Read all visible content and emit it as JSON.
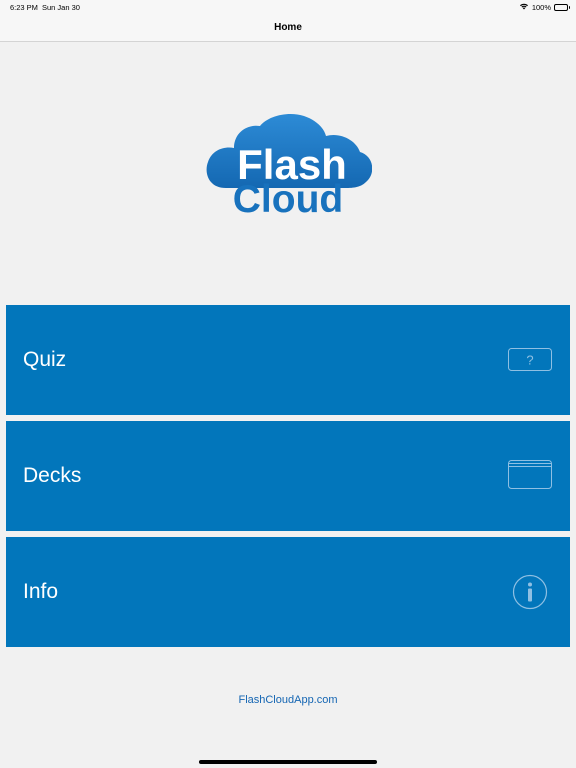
{
  "status_bar": {
    "time": "6:23 PM",
    "date": "Sun Jan 30",
    "battery": "100%"
  },
  "nav": {
    "title": "Home"
  },
  "logo": {
    "line1": "Flash",
    "line2": "Cloud",
    "color": "#1872bd"
  },
  "menu": {
    "quiz_label": "Quiz",
    "quiz_icon_text": "?",
    "decks_label": "Decks",
    "info_label": "Info"
  },
  "footer": {
    "link_text": "FlashCloudApp.com"
  },
  "colors": {
    "button_blue": "#0276bb",
    "background": "#f1f1f1",
    "link": "#1566b3"
  },
  "icons": {
    "quiz": "question-card-icon",
    "decks": "stacked-cards-icon",
    "info": "info-circle-icon",
    "wifi": "wifi-icon",
    "battery": "battery-icon"
  }
}
